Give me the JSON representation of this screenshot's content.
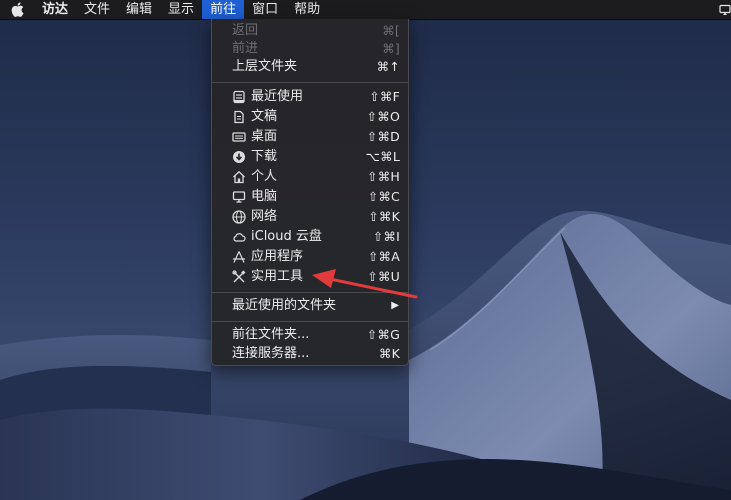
{
  "menubar": {
    "apple_icon": "apple-logo-icon",
    "items": [
      {
        "label": "访达",
        "bold": true
      },
      {
        "label": "文件"
      },
      {
        "label": "编辑"
      },
      {
        "label": "显示"
      },
      {
        "label": "前往",
        "active": true
      },
      {
        "label": "窗口"
      },
      {
        "label": "帮助"
      }
    ],
    "right_icon": "display-mirror-icon"
  },
  "go_menu": {
    "back": {
      "label": "返回",
      "shortcut": "⌘[",
      "enabled": false
    },
    "forward": {
      "label": "前进",
      "shortcut": "⌘]",
      "enabled": false
    },
    "enclosing": {
      "label": "上层文件夹",
      "shortcut": "⌘↑"
    },
    "places": [
      {
        "label": "最近使用",
        "shortcut": "⇧⌘F",
        "icon": "recents-icon"
      },
      {
        "label": "文稿",
        "shortcut": "⇧⌘O",
        "icon": "documents-icon"
      },
      {
        "label": "桌面",
        "shortcut": "⇧⌘D",
        "icon": "desktop-icon"
      },
      {
        "label": "下载",
        "shortcut": "⌥⌘L",
        "icon": "downloads-icon"
      },
      {
        "label": "个人",
        "shortcut": "⇧⌘H",
        "icon": "home-icon"
      },
      {
        "label": "电脑",
        "shortcut": "⇧⌘C",
        "icon": "computer-icon"
      },
      {
        "label": "网络",
        "shortcut": "⇧⌘K",
        "icon": "network-icon"
      },
      {
        "label": "iCloud 云盘",
        "shortcut": "⇧⌘I",
        "icon": "icloud-icon"
      },
      {
        "label": "应用程序",
        "shortcut": "⇧⌘A",
        "icon": "applications-icon"
      },
      {
        "label": "实用工具",
        "shortcut": "⇧⌘U",
        "icon": "utilities-icon"
      }
    ],
    "recent_folders": {
      "label": "最近使用的文件夹",
      "submenu_indicator": "▶"
    },
    "go_to_folder": {
      "label": "前往文件夹...",
      "shortcut": "⇧⌘G"
    },
    "connect_server": {
      "label": "连接服务器...",
      "shortcut": "⌘K"
    }
  },
  "colors": {
    "menubar_bg": "#1c1c1e",
    "active_menu": "#1f5fd3",
    "menu_bg": "#262629",
    "annotation_arrow": "#e23b3b"
  }
}
